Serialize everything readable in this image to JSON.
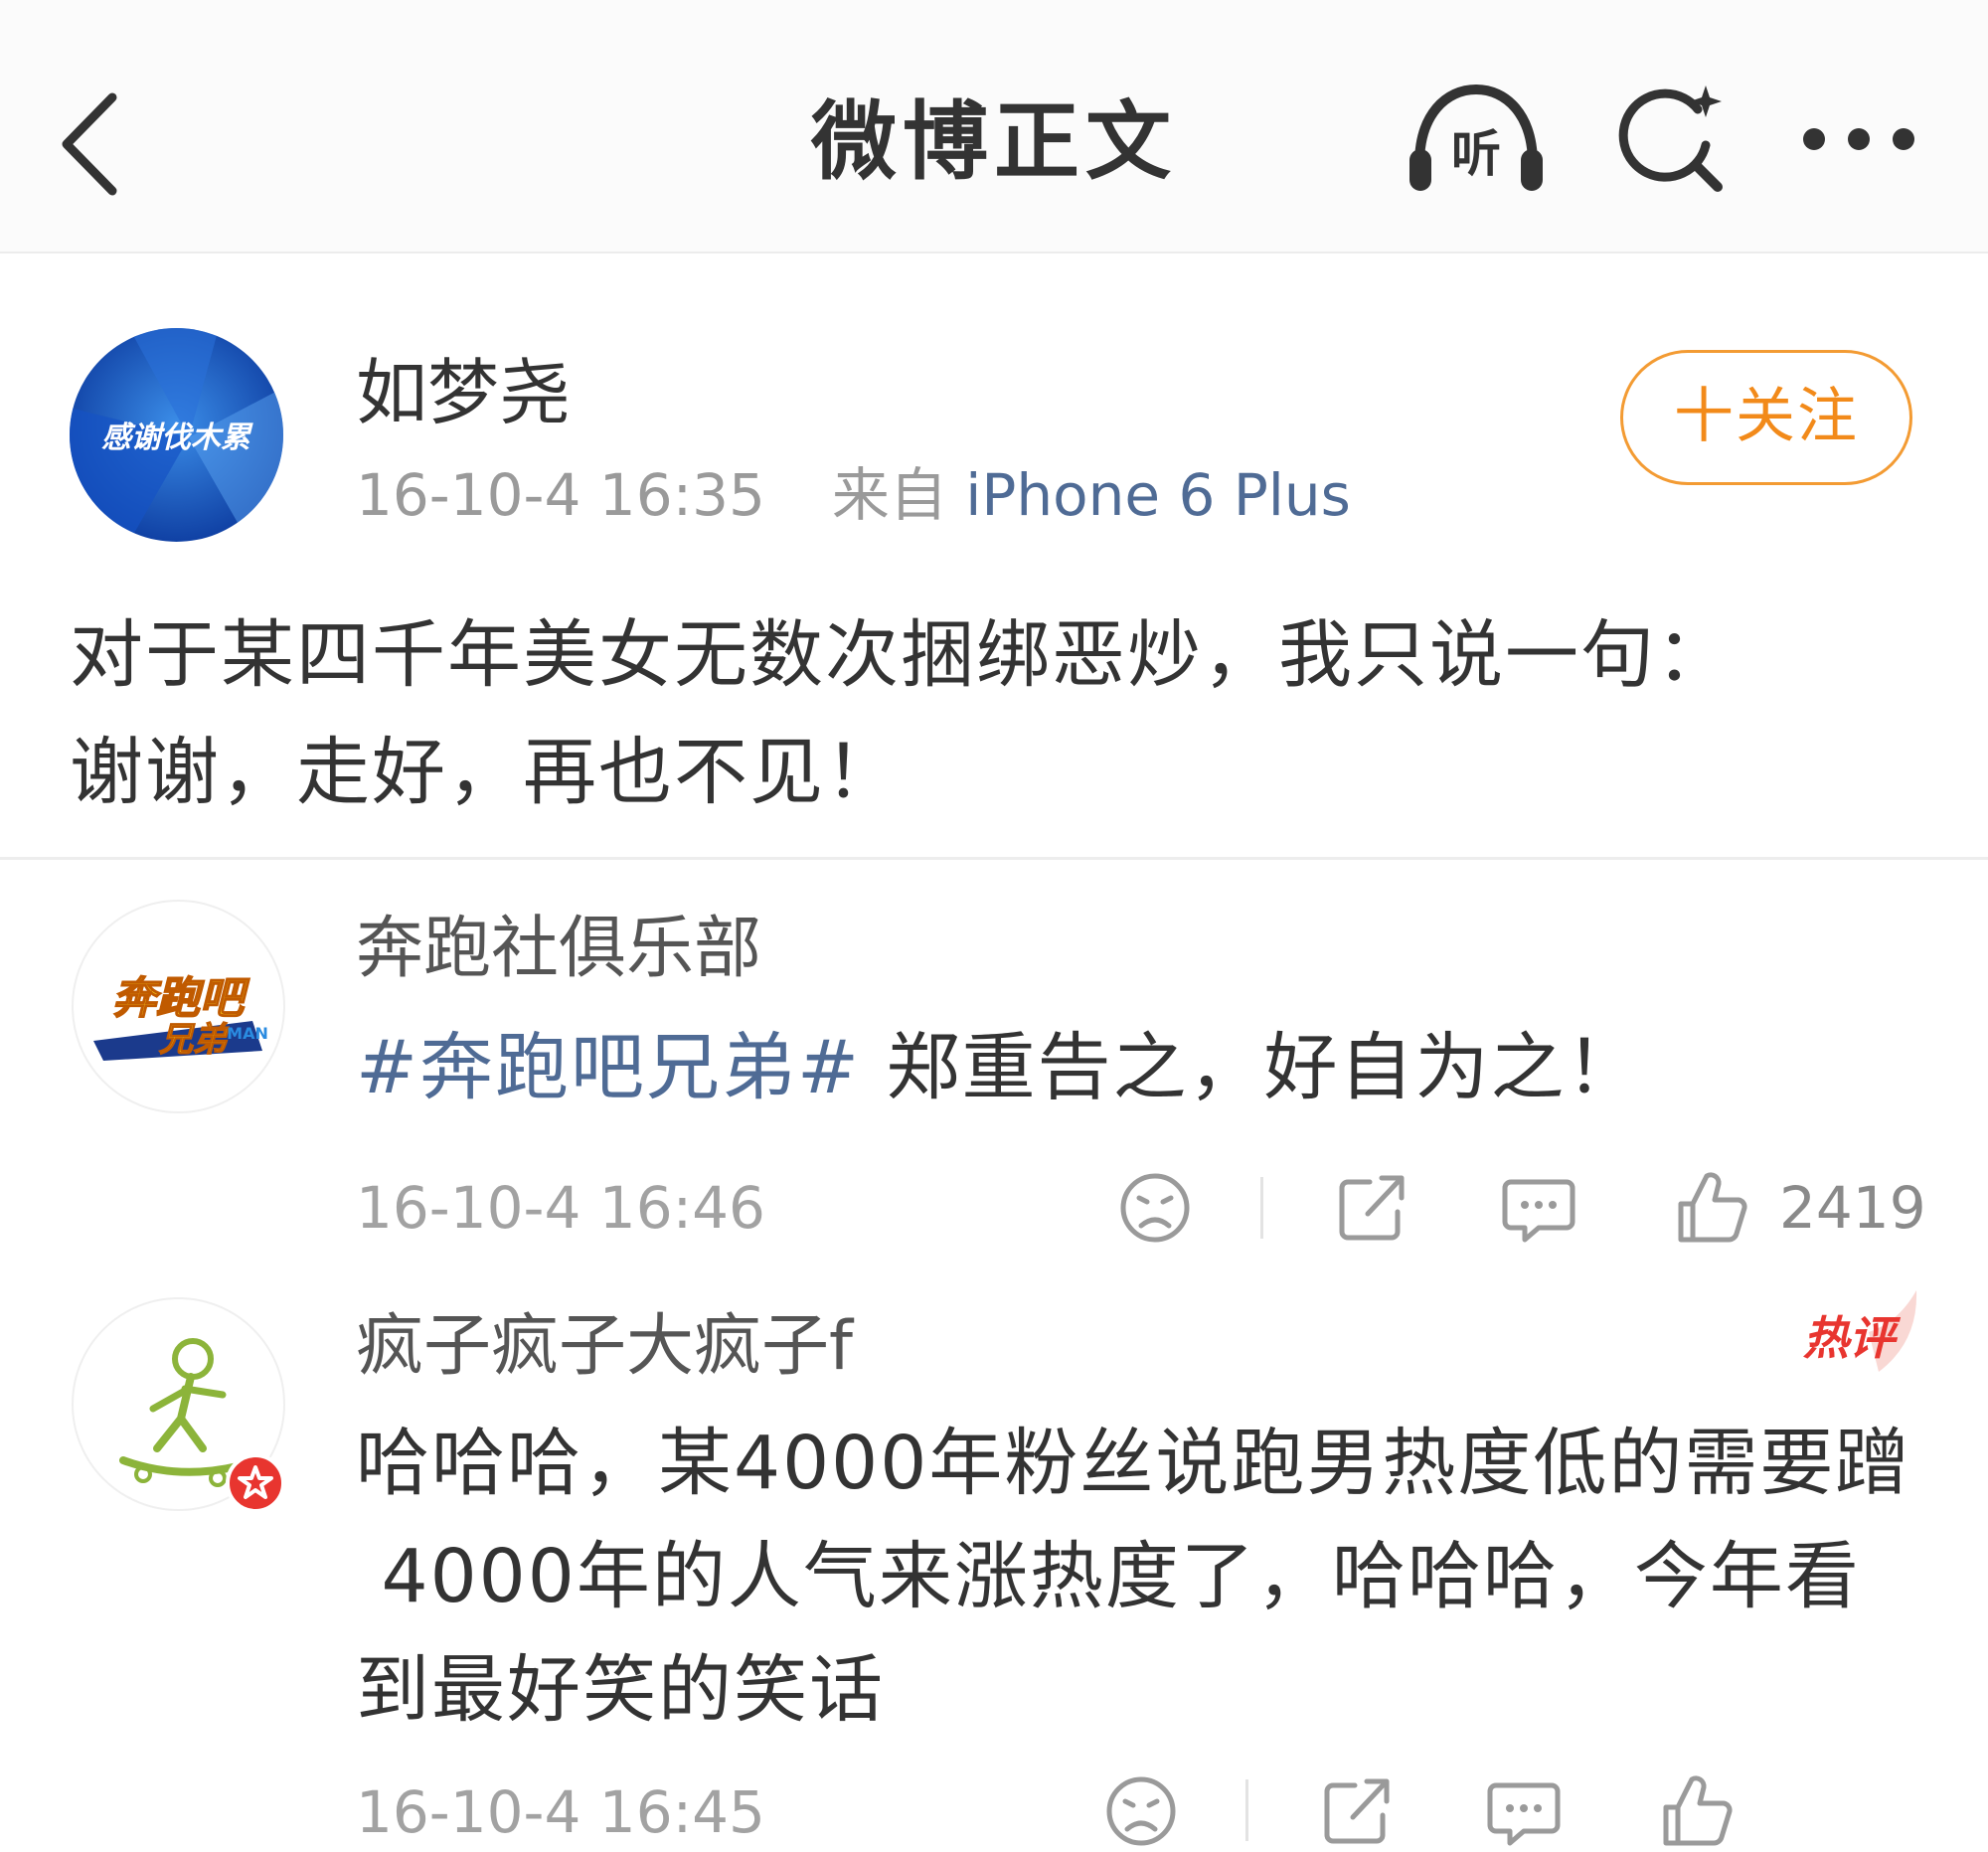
{
  "header": {
    "title": "微博正文",
    "listen_label": "听"
  },
  "post": {
    "avatar_text": "感谢伐木累",
    "username": "如梦尧",
    "time": "16-10-4 16:35",
    "source_prefix": "来自",
    "source": "iPhone 6 Plus",
    "follow_label": "十关注",
    "text_line1": "对于某四千年美女无数次捆绑恶炒，我只说一句：",
    "text_line2": "谢谢，走好，再也不见！"
  },
  "comments": [
    {
      "username": "奔跑社俱乐部",
      "hashtag": "#奔跑吧兄弟#",
      "text": " 郑重告之，好自为之！",
      "time": "16-10-4 16:46",
      "likes": "2419"
    },
    {
      "username": "疯子疯子大疯子f",
      "hot_label": "热评",
      "text_line1": "哈哈哈，某4000年粉丝说跑男热度低的需要蹭",
      "text_line2": " 4000年的人气来涨热度了，哈哈哈，今年看",
      "text_line3": "到最好笑的笑话",
      "time": "16-10-4 16:45"
    }
  ],
  "colors": {
    "accent_orange": "#f28a1a",
    "link_blue": "#4f6b95",
    "hot_red": "#e8352f"
  }
}
